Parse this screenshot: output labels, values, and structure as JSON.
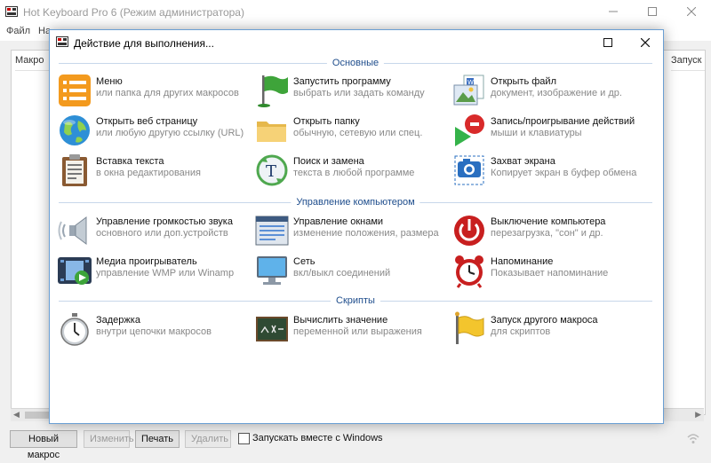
{
  "main_window": {
    "title": "Hot Keyboard Pro 6 (Режим администратора)",
    "menu": [
      "Файл",
      "На"
    ],
    "columns": {
      "left": "Макро",
      "right": "Запуск"
    },
    "bottom_buttons": {
      "new_macro": "Новый макрос",
      "edit": "Изменить",
      "print": "Печать",
      "delete": "Удалить"
    },
    "startup_checkbox_label": "Запускать вместе с Windows"
  },
  "dialog": {
    "title": "Действие для выполнения...",
    "sections": [
      {
        "label": "Основные",
        "items": [
          {
            "icon": "menu-icon",
            "title": "Меню",
            "subtitle": "или папка для других макросов"
          },
          {
            "icon": "flag-icon",
            "title": "Запустить программу",
            "subtitle": "выбрать или задать команду"
          },
          {
            "icon": "file-image-icon",
            "title": "Открыть файл",
            "subtitle": "документ, изображение и др."
          },
          {
            "icon": "globe-icon",
            "title": "Открыть веб страницу",
            "subtitle": "или любую другую ссылку (URL)"
          },
          {
            "icon": "folder-icon",
            "title": "Открыть папку",
            "subtitle": "обычную, сетевую или спец."
          },
          {
            "icon": "record-play-icon",
            "title": "Запись/проигрывание действий",
            "subtitle": "мыши и клавиатуры"
          },
          {
            "icon": "clipboard-icon",
            "title": "Вставка текста",
            "subtitle": "в окна редактирования"
          },
          {
            "icon": "search-replace-icon",
            "title": "Поиск и замена",
            "subtitle": "текста в любой программе"
          },
          {
            "icon": "camera-icon",
            "title": "Захват экрана",
            "subtitle": "Копирует экран в буфер обмена"
          }
        ]
      },
      {
        "label": "Управление компьютером",
        "items": [
          {
            "icon": "speaker-icon",
            "title": "Управление громкостью звука",
            "subtitle": "основного или доп.устройств"
          },
          {
            "icon": "window-icon",
            "title": "Управление окнами",
            "subtitle": "изменение положения, размера"
          },
          {
            "icon": "power-icon",
            "title": "Выключение компьютера",
            "subtitle": "перезагрузка, \"сон\" и др."
          },
          {
            "icon": "media-player-icon",
            "title": "Медиа проигрыватель",
            "subtitle": "управление WMP или Winamp"
          },
          {
            "icon": "monitor-icon",
            "title": "Сеть",
            "subtitle": "вкл/выкл соединений"
          },
          {
            "icon": "alarm-clock-icon",
            "title": "Напоминание",
            "subtitle": "Показывает напоминание"
          }
        ]
      },
      {
        "label": "Скрипты",
        "items": [
          {
            "icon": "stopwatch-icon",
            "title": "Задержка",
            "subtitle": "внутри цепочки макросов"
          },
          {
            "icon": "chalkboard-icon",
            "title": "Вычислить значение",
            "subtitle": "переменной или выражения"
          },
          {
            "icon": "yellow-flag-icon",
            "title": "Запуск другого макроса",
            "subtitle": "для скриптов"
          }
        ]
      }
    ]
  }
}
